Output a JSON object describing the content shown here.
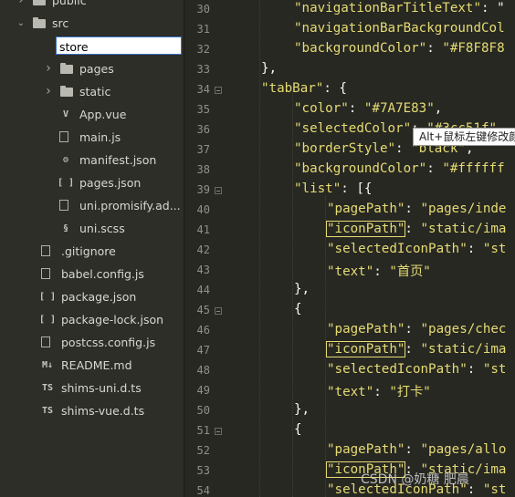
{
  "sidebar": {
    "rename_value": "store",
    "items": [
      {
        "label": "public",
        "kind": "folder",
        "arrow": "collapsed",
        "icon": "folder-icon"
      },
      {
        "label": "src",
        "kind": "folder",
        "arrow": "expanded",
        "icon": "folder-icon"
      },
      {
        "label": "pages",
        "kind": "folder",
        "arrow": "collapsed",
        "icon": "folder-icon"
      },
      {
        "label": "static",
        "kind": "folder",
        "arrow": "collapsed",
        "icon": "folder-icon"
      },
      {
        "label": "App.vue",
        "kind": "file",
        "icon": "vue-icon",
        "glyph": "V"
      },
      {
        "label": "main.js",
        "kind": "file",
        "icon": "js-file-icon",
        "glyph": ""
      },
      {
        "label": "manifest.json",
        "kind": "file",
        "icon": "settings-file-icon",
        "glyph": "⚙"
      },
      {
        "label": "pages.json",
        "kind": "file",
        "icon": "json-icon",
        "glyph": "[ ]"
      },
      {
        "label": "uni.promisify.ad...",
        "kind": "file",
        "icon": "js-file-icon",
        "glyph": ""
      },
      {
        "label": "uni.scss",
        "kind": "file",
        "icon": "scss-icon",
        "glyph": "§"
      },
      {
        "label": ".gitignore",
        "kind": "file",
        "icon": "file-icon",
        "glyph": ""
      },
      {
        "label": "babel.config.js",
        "kind": "file",
        "icon": "js-file-icon",
        "glyph": ""
      },
      {
        "label": "package.json",
        "kind": "file",
        "icon": "json-icon",
        "glyph": "[ ]"
      },
      {
        "label": "package-lock.json",
        "kind": "file",
        "icon": "json-icon",
        "glyph": "[ ]"
      },
      {
        "label": "postcss.config.js",
        "kind": "file",
        "icon": "js-file-icon",
        "glyph": ""
      },
      {
        "label": "README.md",
        "kind": "file",
        "icon": "markdown-icon",
        "glyph": "M↓"
      },
      {
        "label": "shims-uni.d.ts",
        "kind": "file",
        "icon": "ts-icon",
        "glyph": "TS"
      },
      {
        "label": "shims-vue.d.ts",
        "kind": "file",
        "icon": "ts-icon",
        "glyph": "TS"
      }
    ]
  },
  "editor": {
    "lines": [
      {
        "num": "30",
        "code": [
          [
            "s",
            "\"navigationBarTitleText\""
          ],
          [
            "p",
            ": \""
          ]
        ]
      },
      {
        "num": "31",
        "code": [
          [
            "s",
            "\"navigationBarBackgroundCol"
          ]
        ]
      },
      {
        "num": "32",
        "code": [
          [
            "s",
            "\"backgroundColor\""
          ],
          [
            "p",
            ": "
          ],
          [
            "s",
            "\"#F8F8F8"
          ]
        ]
      },
      {
        "num": "33",
        "code": [
          [
            "p",
            "},"
          ]
        ]
      },
      {
        "num": "34",
        "code": [
          [
            "s",
            "\"tabBar\""
          ],
          [
            "p",
            ": {"
          ]
        ],
        "fold": true
      },
      {
        "num": "35",
        "code": [
          [
            "s",
            "\"color\""
          ],
          [
            "p",
            ": "
          ],
          [
            "s",
            "\"#7A7E83\""
          ],
          [
            "p",
            ","
          ]
        ]
      },
      {
        "num": "36",
        "code": [
          [
            "s",
            "\"selectedColor\""
          ],
          [
            "p",
            ": "
          ],
          [
            "s",
            "\"#3cc51f\""
          ],
          [
            "p",
            ","
          ]
        ]
      },
      {
        "num": "37",
        "code": [
          [
            "s",
            "\"borderStyle\""
          ],
          [
            "p",
            ": "
          ],
          [
            "s",
            "\"black\""
          ],
          [
            "p",
            ","
          ]
        ]
      },
      {
        "num": "38",
        "code": [
          [
            "s",
            "\"backgroundColor\""
          ],
          [
            "p",
            ": "
          ],
          [
            "s",
            "\"#ffffff"
          ]
        ]
      },
      {
        "num": "39",
        "code": [
          [
            "s",
            "\"list\""
          ],
          [
            "p",
            ": [{"
          ]
        ],
        "fold": true
      },
      {
        "num": "40",
        "code": [
          [
            "s",
            "\"pagePath\""
          ],
          [
            "p",
            ": "
          ],
          [
            "s",
            "\"pages/inde"
          ]
        ]
      },
      {
        "num": "41",
        "code": [
          [
            "s",
            "\"iconPath\"",
            "hl"
          ],
          [
            "p",
            ": "
          ],
          [
            "s",
            "\"static/ima"
          ]
        ]
      },
      {
        "num": "42",
        "code": [
          [
            "s",
            "\"selectedIconPath\""
          ],
          [
            "p",
            ": "
          ],
          [
            "s",
            "\"st"
          ]
        ]
      },
      {
        "num": "43",
        "code": [
          [
            "s",
            "\"text\""
          ],
          [
            "p",
            ": "
          ],
          [
            "s",
            "\"首页\""
          ]
        ]
      },
      {
        "num": "44",
        "code": [
          [
            "p",
            "},"
          ]
        ]
      },
      {
        "num": "45",
        "code": [
          [
            "p",
            "{"
          ]
        ],
        "fold": true
      },
      {
        "num": "46",
        "code": [
          [
            "s",
            "\"pagePath\""
          ],
          [
            "p",
            ": "
          ],
          [
            "s",
            "\"pages/chec"
          ]
        ]
      },
      {
        "num": "47",
        "code": [
          [
            "s",
            "\"iconPath\"",
            "hl"
          ],
          [
            "p",
            ": "
          ],
          [
            "s",
            "\"static/ima"
          ]
        ]
      },
      {
        "num": "48",
        "code": [
          [
            "s",
            "\"selectedIconPath\""
          ],
          [
            "p",
            ": "
          ],
          [
            "s",
            "\"st"
          ]
        ]
      },
      {
        "num": "49",
        "code": [
          [
            "s",
            "\"text\""
          ],
          [
            "p",
            ": "
          ],
          [
            "s",
            "\"打卡\""
          ]
        ]
      },
      {
        "num": "50",
        "code": [
          [
            "p",
            "},"
          ]
        ]
      },
      {
        "num": "51",
        "code": [
          [
            "p",
            "{"
          ]
        ],
        "fold": true
      },
      {
        "num": "52",
        "code": [
          [
            "s",
            "\"pagePath\""
          ],
          [
            "p",
            ": "
          ],
          [
            "s",
            "\"pages/allo"
          ]
        ]
      },
      {
        "num": "53",
        "code": [
          [
            "s",
            "\"iconPath\"",
            "hl"
          ],
          [
            "p",
            ": "
          ],
          [
            "s",
            "\"static/ima"
          ]
        ]
      },
      {
        "num": "54",
        "code": [
          [
            "s",
            "\"selectedIconPath\""
          ],
          [
            "p",
            ": "
          ],
          [
            "s",
            "\"st"
          ]
        ]
      }
    ]
  },
  "tooltip": "Alt+鼠标左键修改颜",
  "watermark": "CSDN @奶糖 肥晨",
  "colors": {
    "string": "#e6db74",
    "punct": "#f8f8f2",
    "gutter": "#90908a",
    "background": "#272822",
    "sidebar": "#2d2e28"
  }
}
